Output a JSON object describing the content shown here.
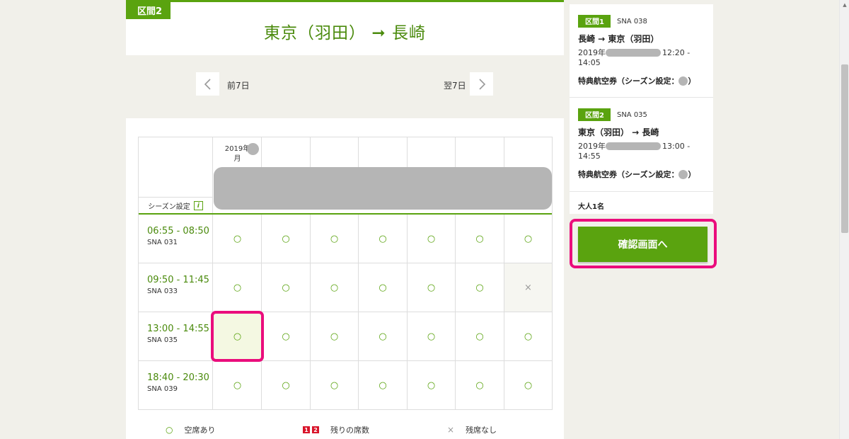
{
  "section": {
    "badge": "区間2",
    "route": "東京（羽田） ➞ 長崎"
  },
  "nav": {
    "prev_label": "前7日",
    "next_label": "翌7日"
  },
  "table": {
    "date_header": "2019年",
    "date_header_suffix": "月",
    "season_label": "シーズン設定",
    "info_icon": "i",
    "rows": [
      {
        "time": "06:55 - 08:50",
        "flight": "SNA 031",
        "cells": [
          "○",
          "○",
          "○",
          "○",
          "○",
          "○",
          "○"
        ]
      },
      {
        "time": "09:50 - 11:45",
        "flight": "SNA 033",
        "cells": [
          "○",
          "○",
          "○",
          "○",
          "○",
          "○",
          "×"
        ]
      },
      {
        "time": "13:00 - 14:55",
        "flight": "SNA 035",
        "cells": [
          "○",
          "○",
          "○",
          "○",
          "○",
          "○",
          "○"
        ]
      },
      {
        "time": "18:40 - 20:30",
        "flight": "SNA 039",
        "cells": [
          "○",
          "○",
          "○",
          "○",
          "○",
          "○",
          "○"
        ]
      }
    ],
    "selected": {
      "row": 2,
      "col": 0
    }
  },
  "legend": {
    "available_symbol": "○",
    "available": "空席あり",
    "remaining_num1": "1",
    "remaining_num2": "2",
    "remaining": "残りの席数",
    "sold_symbol": "×",
    "sold_out": "残席なし"
  },
  "sidebar": {
    "segments": [
      {
        "badge": "区間1",
        "flight": "SNA 038",
        "route": "長崎 → 東京（羽田）",
        "date_prefix": "2019年",
        "time": "12:20 - 14:05",
        "ticket": "特典航空券（シーズン設定：",
        "ticket_close": "）"
      },
      {
        "badge": "区間2",
        "flight": "SNA 035",
        "route": "東京（羽田） → 長崎",
        "date_prefix": "2019年",
        "time": "13:00 - 14:55",
        "ticket": "特典航空券（シーズン設定：",
        "ticket_close": "）"
      }
    ],
    "passengers": "大人1名",
    "confirm_label": "確認画面へ"
  },
  "colors": {
    "accent": "#5aa30f",
    "accent_text": "#4a8a0c",
    "highlight": "#ea0d7c",
    "redaction": "#b5b5b5"
  }
}
